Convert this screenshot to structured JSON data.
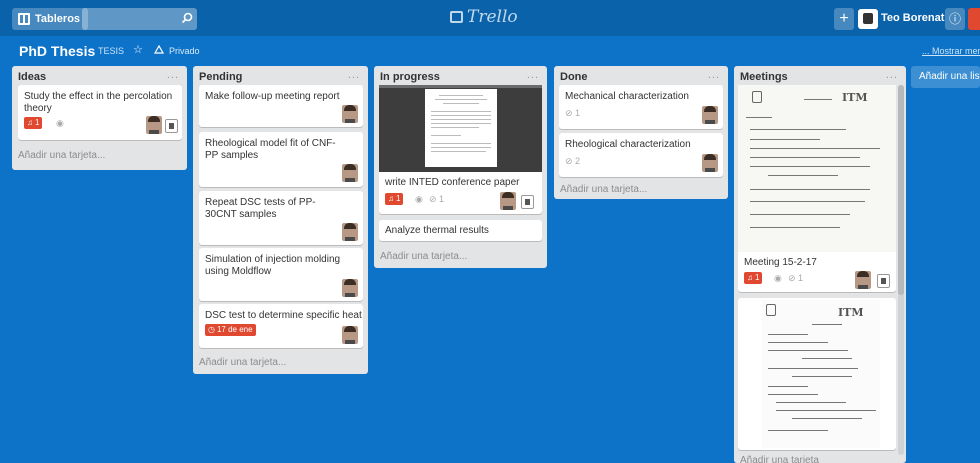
{
  "header": {
    "boards_button": "Tableros",
    "logo": "Trello",
    "plus": "+",
    "user_name": "Teo Borenat",
    "info": "ⓘ"
  },
  "board": {
    "title": "PhD Thesis",
    "team": "TESIS",
    "privacy": "Privado",
    "show_menu": "... Mostrar menú"
  },
  "lists": [
    {
      "name": "Ideas",
      "menu": "...",
      "cards": [
        {
          "title": "Study the effect in the percolation theory",
          "badge": "1"
        }
      ],
      "add_card": "Añadir una tarjeta..."
    },
    {
      "name": "Pending",
      "menu": "...",
      "cards": [
        {
          "title": "Make follow-up meeting report"
        },
        {
          "title": "Rheological model fit of CNF-PP samples"
        },
        {
          "title": "Repeat DSC tests of PP-30CNT samples"
        },
        {
          "title": "Simulation of injection molding using Moldflow"
        },
        {
          "title": "DSC test to determine specific heat",
          "due": "17 de ene"
        }
      ],
      "add_card": "Añadir una tarjeta..."
    },
    {
      "name": "In progress",
      "menu": "...",
      "cards": [
        {
          "title": "write INTED conference paper",
          "badge": "1",
          "attachments": "1"
        },
        {
          "title": "Analyze thermal results"
        }
      ],
      "add_card": "Añadir una tarjeta..."
    },
    {
      "name": "Done",
      "menu": "...",
      "cards": [
        {
          "title": "Mechanical characterization",
          "attachments": "1"
        },
        {
          "title": "Rheological characterization",
          "attachments": "2"
        }
      ],
      "add_card": "Añadir una tarjeta..."
    },
    {
      "name": "Meetings",
      "menu": "...",
      "cards": [
        {
          "title": "Meeting 15-2-17",
          "badge": "1",
          "attachments": "1",
          "note_logo": "ITM"
        },
        {
          "note_logo": "ITM"
        }
      ],
      "add_card": "Añadir una tarjeta"
    }
  ],
  "add_list": "Añadir una lista...",
  "colors": {
    "board_bg": "#0c73c9",
    "header_bg": "#0a62aa",
    "list_bg": "#e2e4e6",
    "label_red": "#e0482f"
  }
}
